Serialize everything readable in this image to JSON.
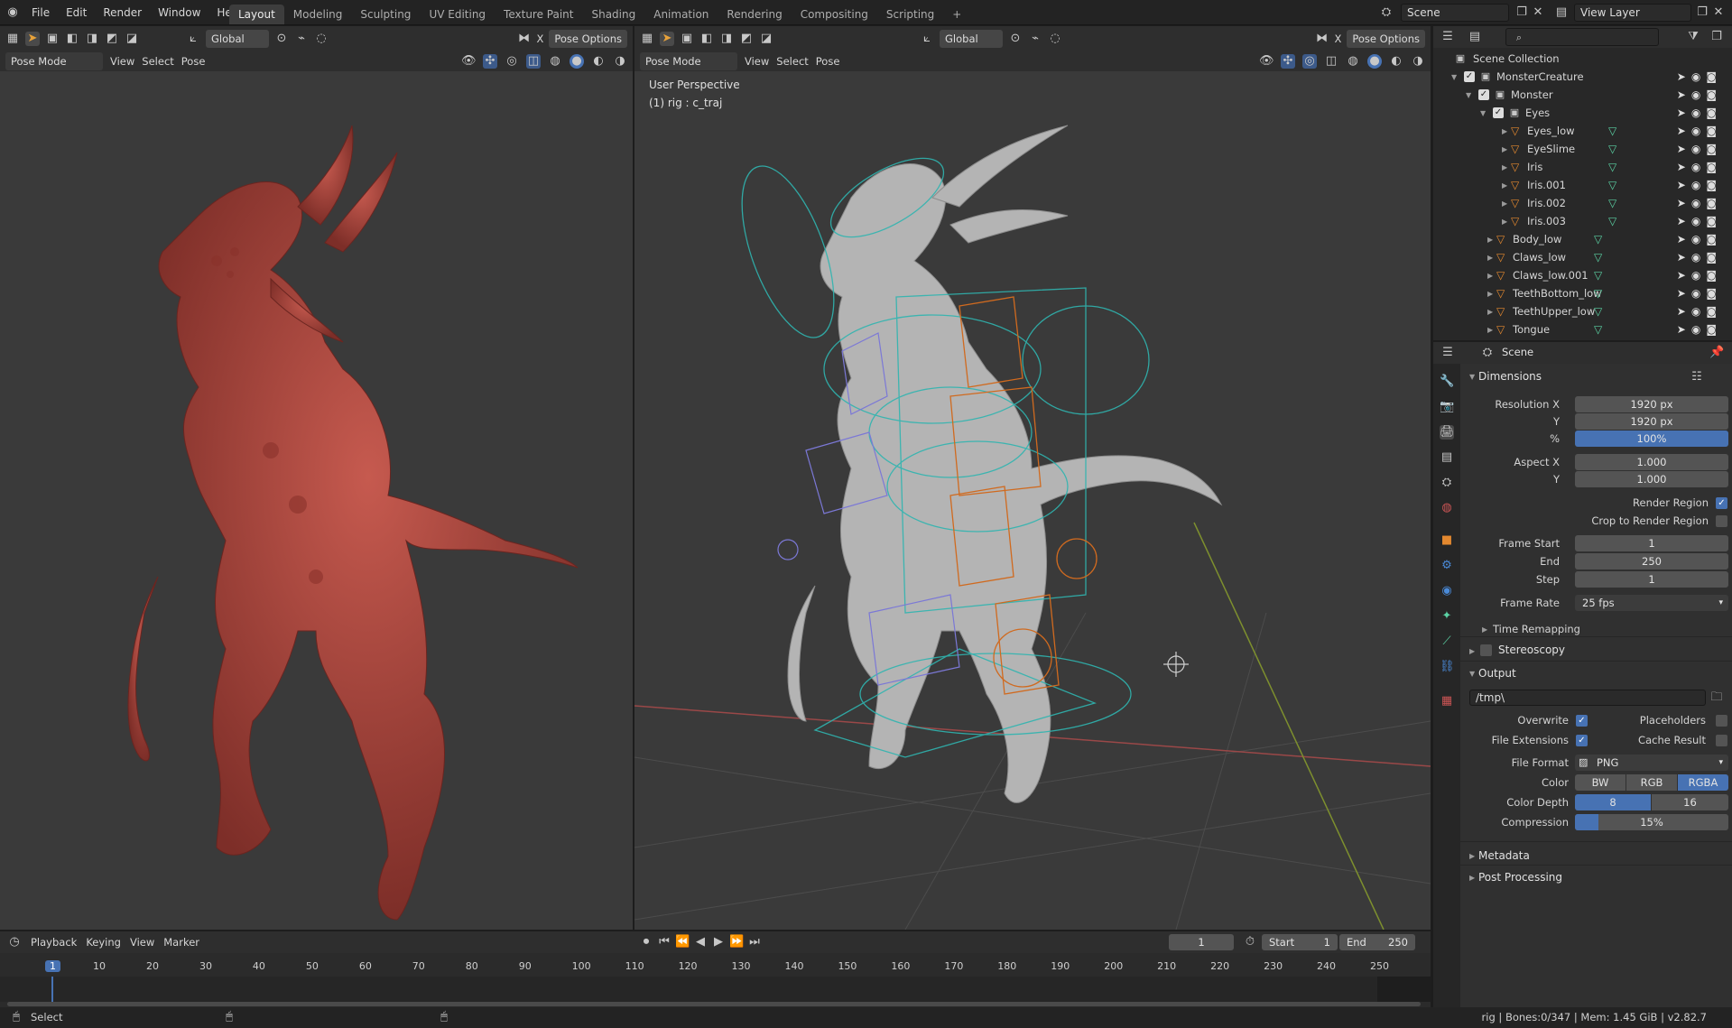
{
  "topbar": {
    "menus": [
      "File",
      "Edit",
      "Render",
      "Window",
      "Help"
    ],
    "workspaces": [
      "Layout",
      "Modeling",
      "Sculpting",
      "UV Editing",
      "Texture Paint",
      "Shading",
      "Animation",
      "Rendering",
      "Compositing",
      "Scripting"
    ],
    "add_tab": "+",
    "scene": "Scene",
    "view_layer": "View Layer"
  },
  "left_vp": {
    "transform": "Global",
    "pose_options": "Pose Options",
    "mode": "Pose Mode",
    "menus": [
      "View",
      "Select",
      "Pose"
    ]
  },
  "right_vp": {
    "transform": "Global",
    "pose_options": "Pose Options",
    "mode": "Pose Mode",
    "menus": [
      "View",
      "Select",
      "Pose"
    ],
    "overlay_title": "User Perspective",
    "overlay_sub": "(1) rig : c_traj"
  },
  "outliner": {
    "root": "Scene Collection",
    "rows": [
      {
        "name": "MonsterCreature",
        "depth": 1,
        "type": "collection"
      },
      {
        "name": "Monster",
        "depth": 2,
        "type": "collection"
      },
      {
        "name": "Eyes",
        "depth": 3,
        "type": "collection"
      },
      {
        "name": "Eyes_low",
        "depth": 4,
        "type": "object"
      },
      {
        "name": "EyeSlime",
        "depth": 4,
        "type": "object"
      },
      {
        "name": "Iris",
        "depth": 4,
        "type": "object"
      },
      {
        "name": "Iris.001",
        "depth": 4,
        "type": "object"
      },
      {
        "name": "Iris.002",
        "depth": 4,
        "type": "object"
      },
      {
        "name": "Iris.003",
        "depth": 4,
        "type": "object"
      },
      {
        "name": "Body_low",
        "depth": 3,
        "type": "object"
      },
      {
        "name": "Claws_low",
        "depth": 3,
        "type": "object"
      },
      {
        "name": "Claws_low.001",
        "depth": 3,
        "type": "object"
      },
      {
        "name": "TeethBottom_low",
        "depth": 3,
        "type": "object"
      },
      {
        "name": "TeethUpper_low",
        "depth": 3,
        "type": "object"
      },
      {
        "name": "Tongue",
        "depth": 3,
        "type": "object"
      }
    ]
  },
  "props": {
    "context": "Scene",
    "dimensions": "Dimensions",
    "res_x_label": "Resolution X",
    "res_x": "1920 px",
    "res_y_label": "Y",
    "res_y": "1920 px",
    "pct_label": "%",
    "pct": "100%",
    "aspect_x_label": "Aspect X",
    "aspect_x": "1.000",
    "aspect_y_label": "Y",
    "aspect_y": "1.000",
    "render_region": "Render Region",
    "crop_region": "Crop to Render Region",
    "frame_start_label": "Frame Start",
    "frame_start": "1",
    "end_label": "End",
    "end": "250",
    "step_label": "Step",
    "step": "1",
    "frame_rate_label": "Frame Rate",
    "frame_rate": "25 fps",
    "time_remapping": "Time Remapping",
    "stereoscopy": "Stereoscopy",
    "output": "Output",
    "path": "/tmp\\",
    "overwrite": "Overwrite",
    "placeholders": "Placeholders",
    "file_ext": "File Extensions",
    "cache_result": "Cache Result",
    "file_format_label": "File Format",
    "file_format": "PNG",
    "color_label": "Color",
    "color_opts": [
      "BW",
      "RGB",
      "RGBA"
    ],
    "depth_label": "Color Depth",
    "depth_opts": [
      "8",
      "16"
    ],
    "compression_label": "Compression",
    "compression": "15%",
    "compression_fraction": 0.15,
    "metadata": "Metadata",
    "post_processing": "Post Processing"
  },
  "timeline": {
    "menus": [
      "Playback",
      "Keying",
      "View",
      "Marker"
    ],
    "current_frame": "1",
    "start_label": "Start",
    "start": "1",
    "end_label": "End",
    "end": "250",
    "ticks": [
      "1",
      "10",
      "20",
      "30",
      "40",
      "50",
      "60",
      "70",
      "80",
      "90",
      "100",
      "110",
      "120",
      "130",
      "140",
      "150",
      "160",
      "170",
      "180",
      "190",
      "200",
      "210",
      "220",
      "230",
      "240",
      "250"
    ]
  },
  "status": {
    "left": "Select",
    "right": "rig | Bones:0/347 | Mem: 1.45 GiB | v2.82.7"
  },
  "colors": {
    "accent": "#4772b3",
    "object": "#e3882f",
    "mesh": "#5bd2a4",
    "creature_left": "#a8463e",
    "creature_right": "#b5b5b5"
  }
}
